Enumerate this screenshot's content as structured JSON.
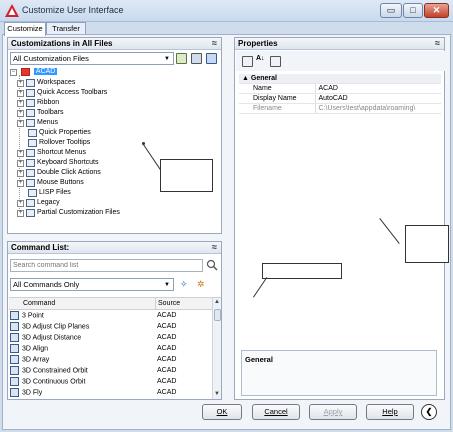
{
  "window": {
    "title": "Customize User Interface",
    "minimize_glyph": "▭",
    "maximize_glyph": "□",
    "close_glyph": "✕"
  },
  "tabs": [
    {
      "label": "Customize"
    },
    {
      "label": "Transfer"
    }
  ],
  "customizations_panel": {
    "title": "Customizations in All Files",
    "collapse_glyph": "≈",
    "filter_value": "All Customization Files",
    "tree": [
      {
        "label": "ACAD"
      },
      {
        "label": "Workspaces"
      },
      {
        "label": "Quick Access Toolbars"
      },
      {
        "label": "Ribbon"
      },
      {
        "label": "Toolbars"
      },
      {
        "label": "Menus"
      },
      {
        "label": "Quick Properties"
      },
      {
        "label": "Rollover Tooltips"
      },
      {
        "label": "Shortcut Menus"
      },
      {
        "label": "Keyboard Shortcuts"
      },
      {
        "label": "Double Click Actions"
      },
      {
        "label": "Mouse Buttons"
      },
      {
        "label": "LISP Files"
      },
      {
        "label": "Legacy"
      },
      {
        "label": "Partial Customization Files"
      }
    ]
  },
  "command_list": {
    "title": "Command List:",
    "collapse_glyph": "≈",
    "search_placeholder": "Search command list",
    "filter_value": "All Commands Only",
    "columns": {
      "command": "Command",
      "source": "Source"
    },
    "rows": [
      {
        "command": "3 Point",
        "source": "ACAD"
      },
      {
        "command": "3D Adjust Clip Planes",
        "source": "ACAD"
      },
      {
        "command": "3D Adjust Distance",
        "source": "ACAD"
      },
      {
        "command": "3D Align",
        "source": "ACAD"
      },
      {
        "command": "3D Array",
        "source": "ACAD"
      },
      {
        "command": "3D Constrained Orbit",
        "source": "ACAD"
      },
      {
        "command": "3D Continuous Orbit",
        "source": "ACAD"
      },
      {
        "command": "3D Fly",
        "source": "ACAD"
      }
    ]
  },
  "properties_panel": {
    "title": "Properties",
    "collapse_glyph": "≈",
    "category": "General",
    "rows": [
      {
        "name": "Name",
        "value": "ACAD"
      },
      {
        "name": "Display Name",
        "value": "AutoCAD"
      },
      {
        "name": "Filename",
        "value": "C:\\Users\\test\\appdata\\roaming\\"
      }
    ],
    "description_title": "General"
  },
  "buttons": {
    "ok": "OK",
    "cancel": "Cancel",
    "apply": "Apply",
    "help": "Help",
    "collapse_glyph": "❮"
  }
}
